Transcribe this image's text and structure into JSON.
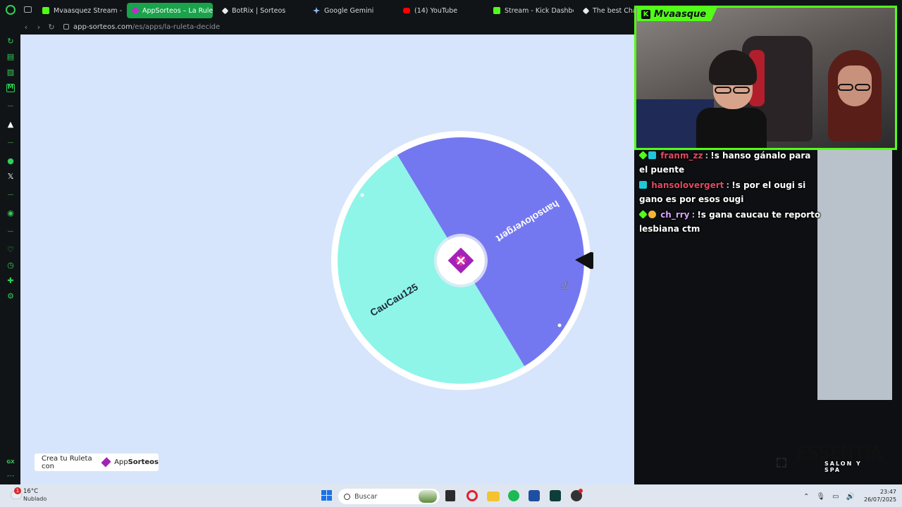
{
  "browser": {
    "tabs": [
      {
        "label": "Mvaasquez Stream - Wat",
        "favicon": "kick-icon",
        "active": false
      },
      {
        "label": "AppSorteos – La Ruleta d",
        "favicon": "appsorteos-icon",
        "active": true
      },
      {
        "label": "BotRix | Sorteos",
        "favicon": "botrix-icon",
        "active": false
      },
      {
        "label": "Google Gemini",
        "favicon": "gemini-icon",
        "active": false
      },
      {
        "label": "(14) YouTube",
        "favicon": "youtube-icon",
        "active": false
      },
      {
        "label": "Stream - Kick Dashboard",
        "favicon": "kick-icon",
        "active": false
      },
      {
        "label": "The best ChatB",
        "favicon": "chatgpt-icon",
        "active": false
      }
    ],
    "address": {
      "domain": "app-sorteos.com",
      "path": "/es/apps/la-ruleta-decide"
    }
  },
  "wheel": {
    "segments": [
      {
        "label": "hansolovergert",
        "color": "#7478f0"
      },
      {
        "label": "CauCau125",
        "color": "#8ef5e8"
      }
    ],
    "rim_color": "#ffffff",
    "center_logo": "appsorteos-logo-icon",
    "pointer": "pointer-icon"
  },
  "promo": {
    "prefix": "Crea tu Ruleta con",
    "brand_a": "App",
    "brand_b": "Sorteos"
  },
  "stream": {
    "channel_name": "Mvaasque",
    "accent": "#53fc18",
    "chat": [
      {
        "user": "franm_zz",
        "text": "!s hanso gánalo para el puente"
      },
      {
        "user": "hansolovergert",
        "text": "!s por el ougi si gano es por esos ougi"
      },
      {
        "user": "ch_rry",
        "text": "!s gana caucau te reporto lesbiana ctm"
      }
    ],
    "sponsor": {
      "name": "ESSENTIA",
      "sub": "SALON Y SPA"
    }
  },
  "taskbar": {
    "weather": {
      "alert_count": "1",
      "temp": "16°C",
      "condition": "Nublado"
    },
    "search_placeholder": "Buscar",
    "time": "23:47",
    "date": "26/07/2025"
  }
}
